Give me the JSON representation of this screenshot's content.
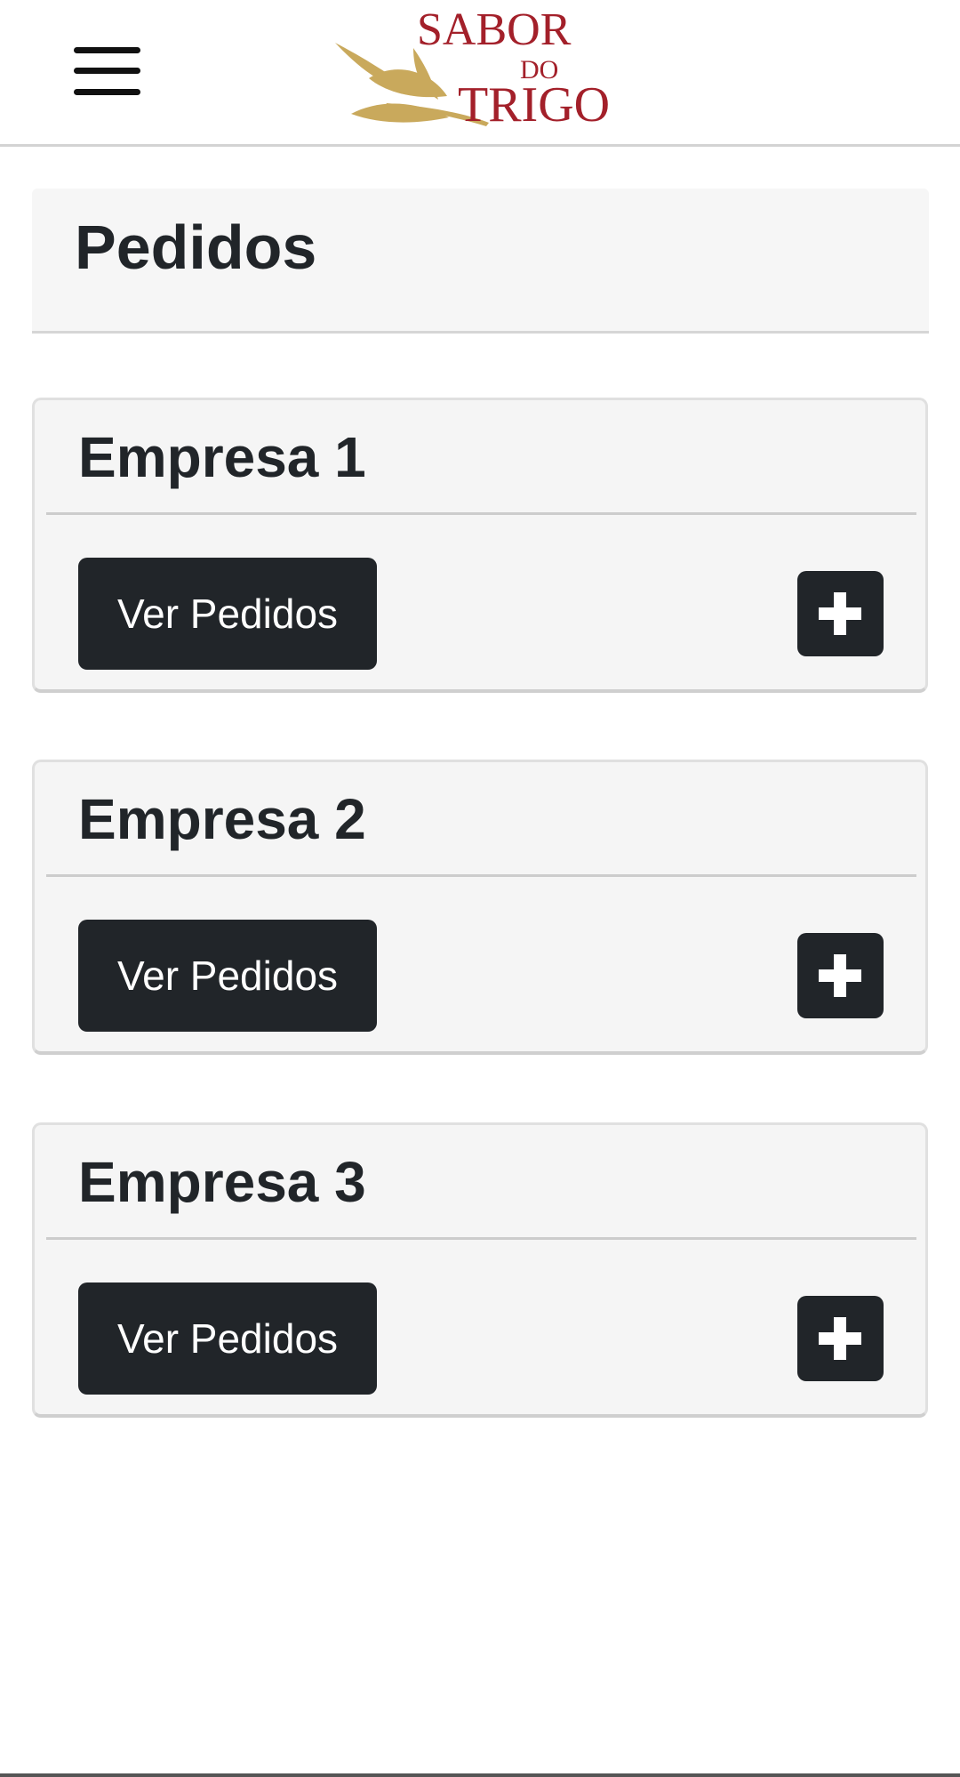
{
  "navbar": {
    "menu_icon": "hamburger-menu-icon",
    "logo": {
      "line1": "SABOR",
      "line2": "DO",
      "line3": "TRIGO",
      "text_color": "#a3202a",
      "leaf_color": "#c9a95c"
    }
  },
  "page": {
    "title": "Pedidos"
  },
  "companies": [
    {
      "name": "Empresa 1",
      "view_label": "Ver Pedidos",
      "add_icon": "plus-icon"
    },
    {
      "name": "Empresa 2",
      "view_label": "Ver Pedidos",
      "add_icon": "plus-icon"
    },
    {
      "name": "Empresa 3",
      "view_label": "Ver Pedidos",
      "add_icon": "plus-icon"
    }
  ],
  "colors": {
    "dark": "#212529",
    "card_bg": "#f5f5f5",
    "header_bg": "#f6f6f6"
  }
}
